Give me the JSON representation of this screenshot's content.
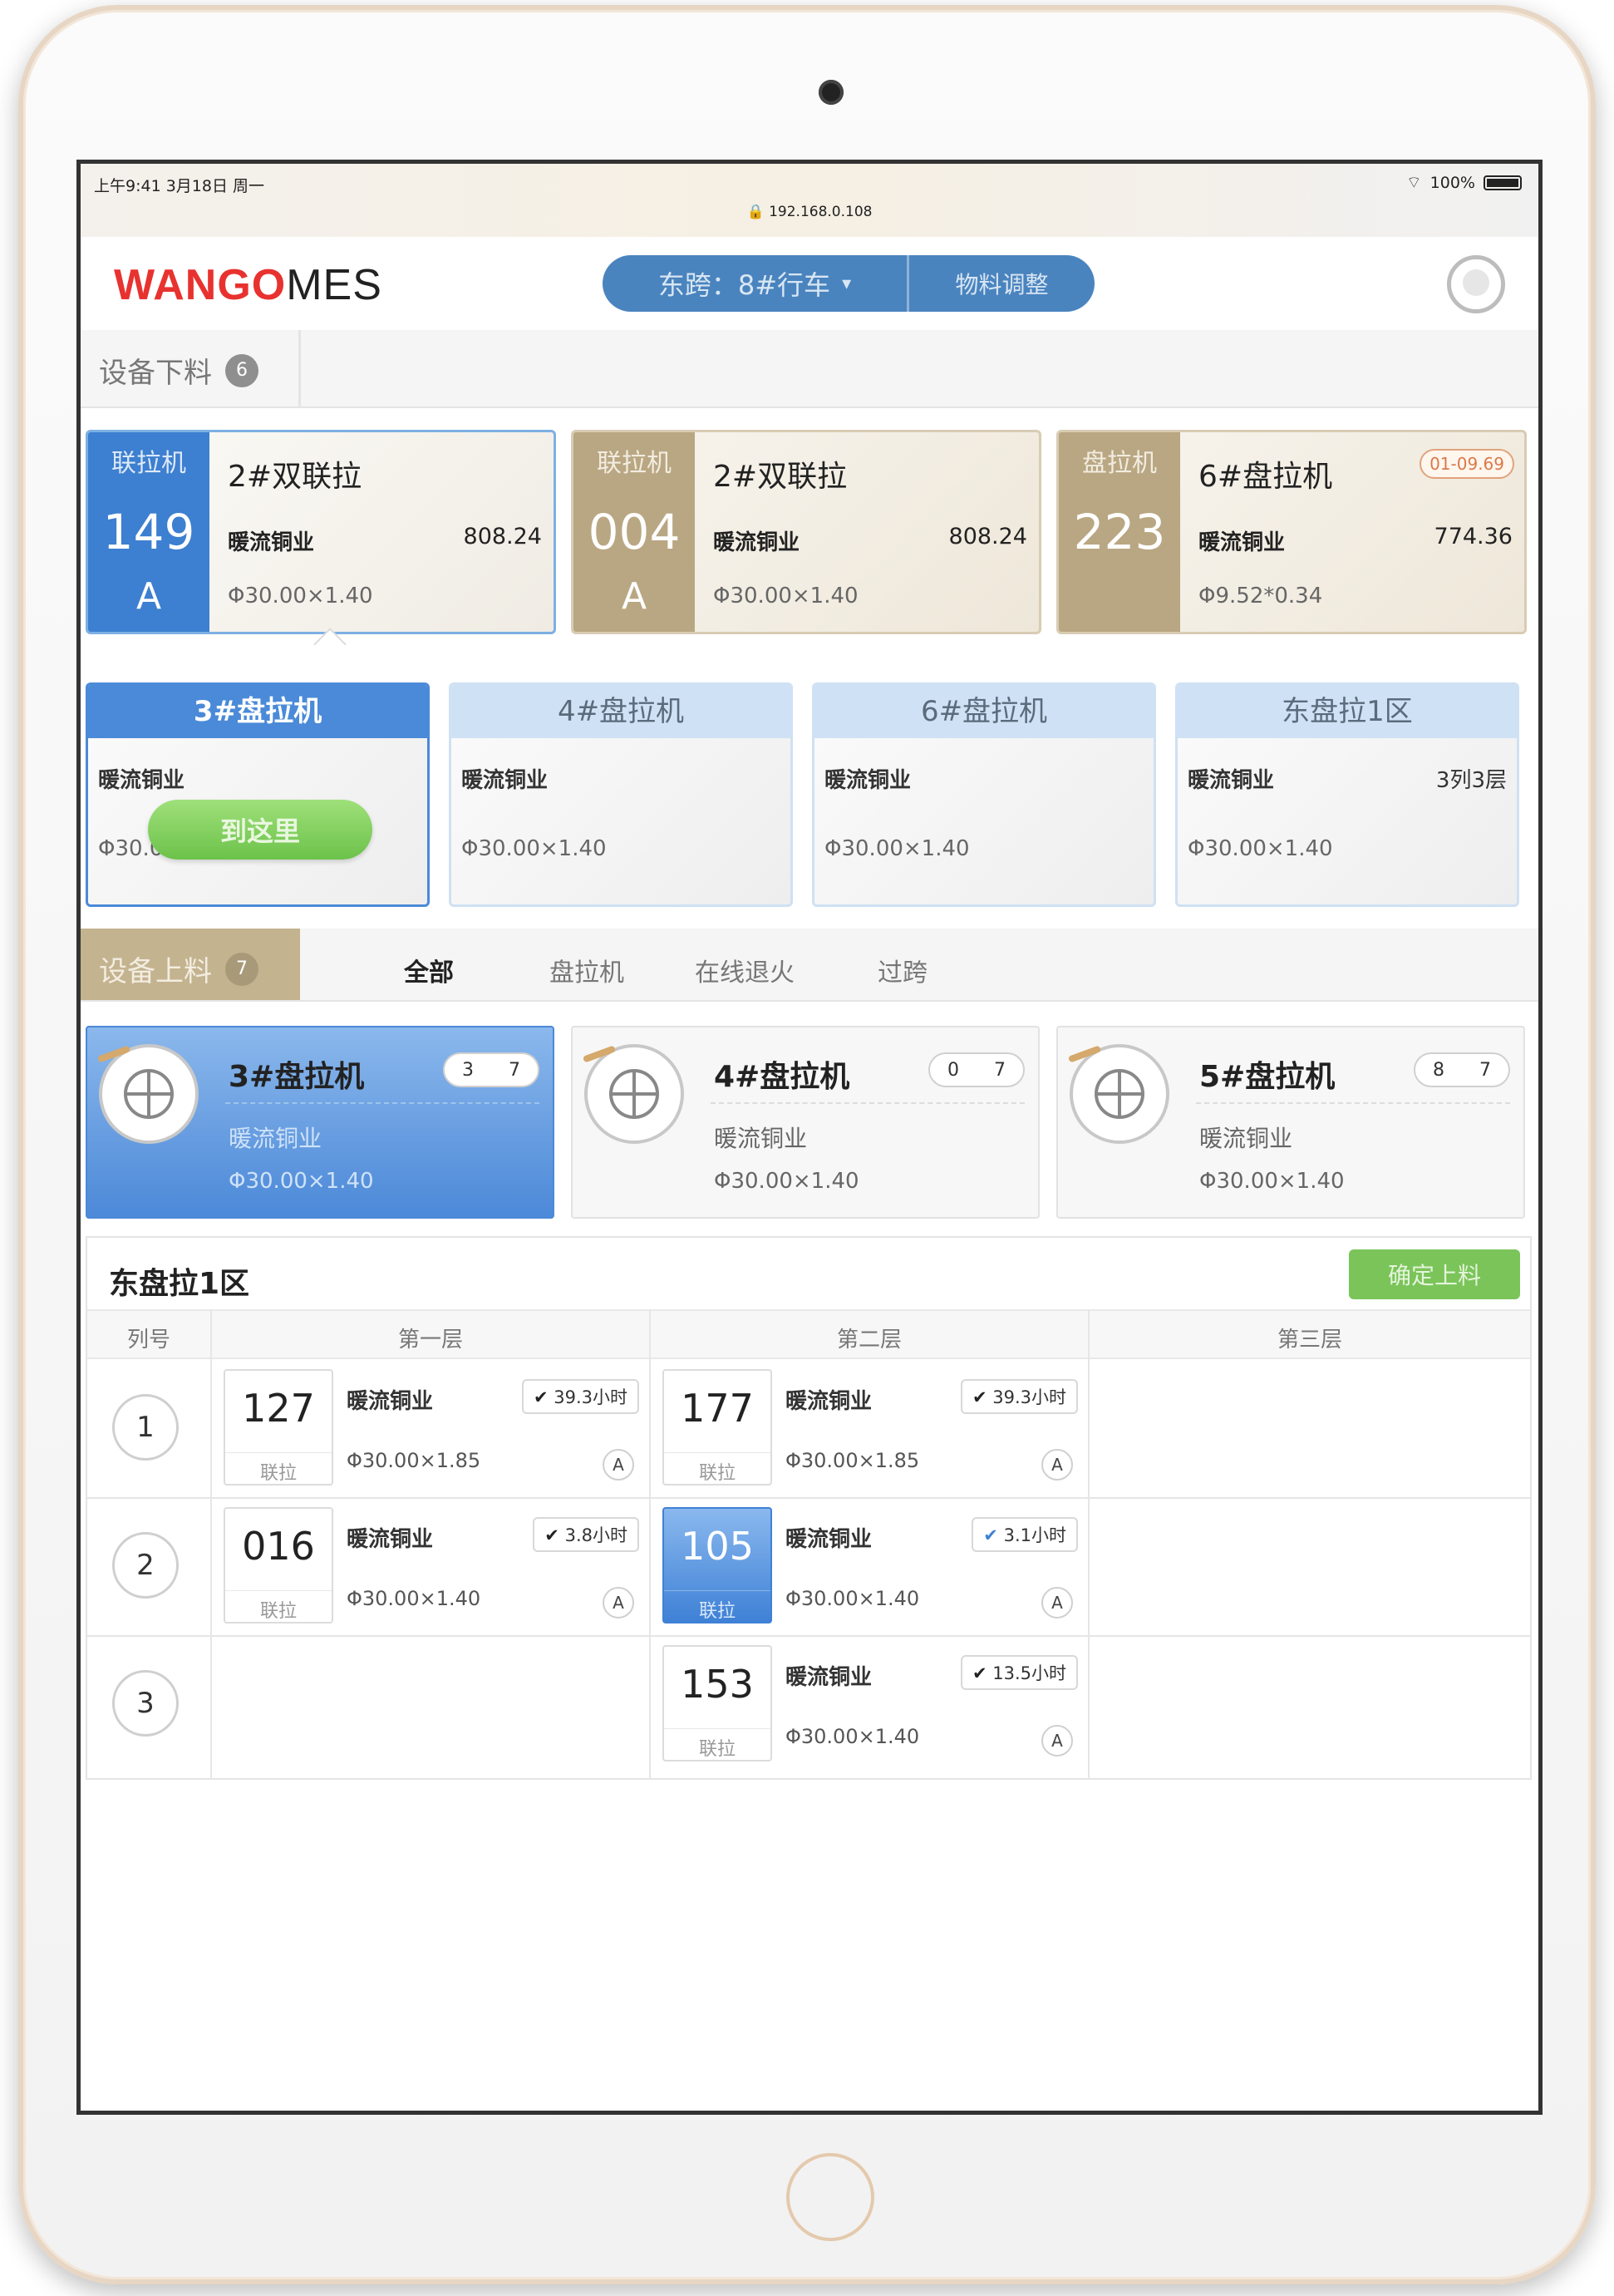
{
  "status": {
    "time": "上午9:41  3月18日 周一",
    "url": "🔒 192.168.0.108",
    "battery": "100%"
  },
  "header": {
    "logo_red": "WANGO",
    "logo_dark": "MES",
    "location": "东跨：8#行车",
    "location_arrow": "▾",
    "material_adjust": "物料调整"
  },
  "unload": {
    "title": "设备下料",
    "count": "6",
    "cards": [
      {
        "type": "联拉机",
        "num": "149",
        "grade": "A",
        "name": "2#双联拉",
        "company": "暖流铜业",
        "weight": "808.24",
        "spec": "Φ30.00×1.40",
        "date": ""
      },
      {
        "type": "联拉机",
        "num": "004",
        "grade": "A",
        "name": "2#双联拉",
        "company": "暖流铜业",
        "weight": "808.24",
        "spec": "Φ30.00×1.40",
        "date": ""
      },
      {
        "type": "盘拉机",
        "num": "223",
        "grade": "",
        "name": "6#盘拉机",
        "company": "暖流铜业",
        "weight": "774.36",
        "spec": "Φ9.52*0.34",
        "date": "01-09.69"
      }
    ]
  },
  "targets": [
    {
      "name": "3#盘拉机",
      "company": "暖流铜业",
      "pos": "",
      "spec": "Φ30.00×1.40",
      "action": "到这里"
    },
    {
      "name": "4#盘拉机",
      "company": "暖流铜业",
      "pos": "",
      "spec": "Φ30.00×1.40"
    },
    {
      "name": "6#盘拉机",
      "company": "暖流铜业",
      "pos": "",
      "spec": "Φ30.00×1.40"
    },
    {
      "name": "东盘拉1区",
      "company": "暖流铜业",
      "pos": "3列3层",
      "spec": "Φ30.00×1.40"
    }
  ],
  "load": {
    "title": "设备上料",
    "count": "7",
    "tabs": [
      "全部",
      "盘拉机",
      "在线退火",
      "过跨"
    ],
    "machines": [
      {
        "name": "3#盘拉机",
        "c1": "3",
        "c2": "7",
        "company": "暖流铜业",
        "spec": "Φ30.00×1.40"
      },
      {
        "name": "4#盘拉机",
        "c1": "0",
        "c2": "7",
        "company": "暖流铜业",
        "spec": "Φ30.00×1.40"
      },
      {
        "name": "5#盘拉机",
        "c1": "8",
        "c2": "7",
        "company": "暖流铜业",
        "spec": "Φ30.00×1.40"
      }
    ]
  },
  "rack": {
    "title": "东盘拉1区",
    "confirm": "确定上料",
    "headers": [
      "列号",
      "第一层",
      "第二层",
      "第三层"
    ],
    "rows": [
      "1",
      "2",
      "3"
    ],
    "coils": [
      {
        "code": "127",
        "kind": "联拉",
        "company": "暖流铜业",
        "spec": "Φ30.00×1.85",
        "time": "39.3小时",
        "grade": "A"
      },
      {
        "code": "177",
        "kind": "联拉",
        "company": "暖流铜业",
        "spec": "Φ30.00×1.85",
        "time": "39.3小时",
        "grade": "A"
      },
      {
        "code": "016",
        "kind": "联拉",
        "company": "暖流铜业",
        "spec": "Φ30.00×1.40",
        "time": "3.8小时",
        "grade": "A"
      },
      {
        "code": "105",
        "kind": "联拉",
        "company": "暖流铜业",
        "spec": "Φ30.00×1.40",
        "time": "3.1小时",
        "grade": "A"
      },
      {
        "code": "153",
        "kind": "联拉",
        "company": "暖流铜业",
        "spec": "Φ30.00×1.40",
        "time": "13.5小时",
        "grade": "A"
      }
    ],
    "check": "✔"
  },
  "colors": {
    "brand_red": "#e8322f",
    "primary_blue": "#4a84bf",
    "confirm_green": "#7ac45a",
    "unload_tan": "#b9a783"
  }
}
